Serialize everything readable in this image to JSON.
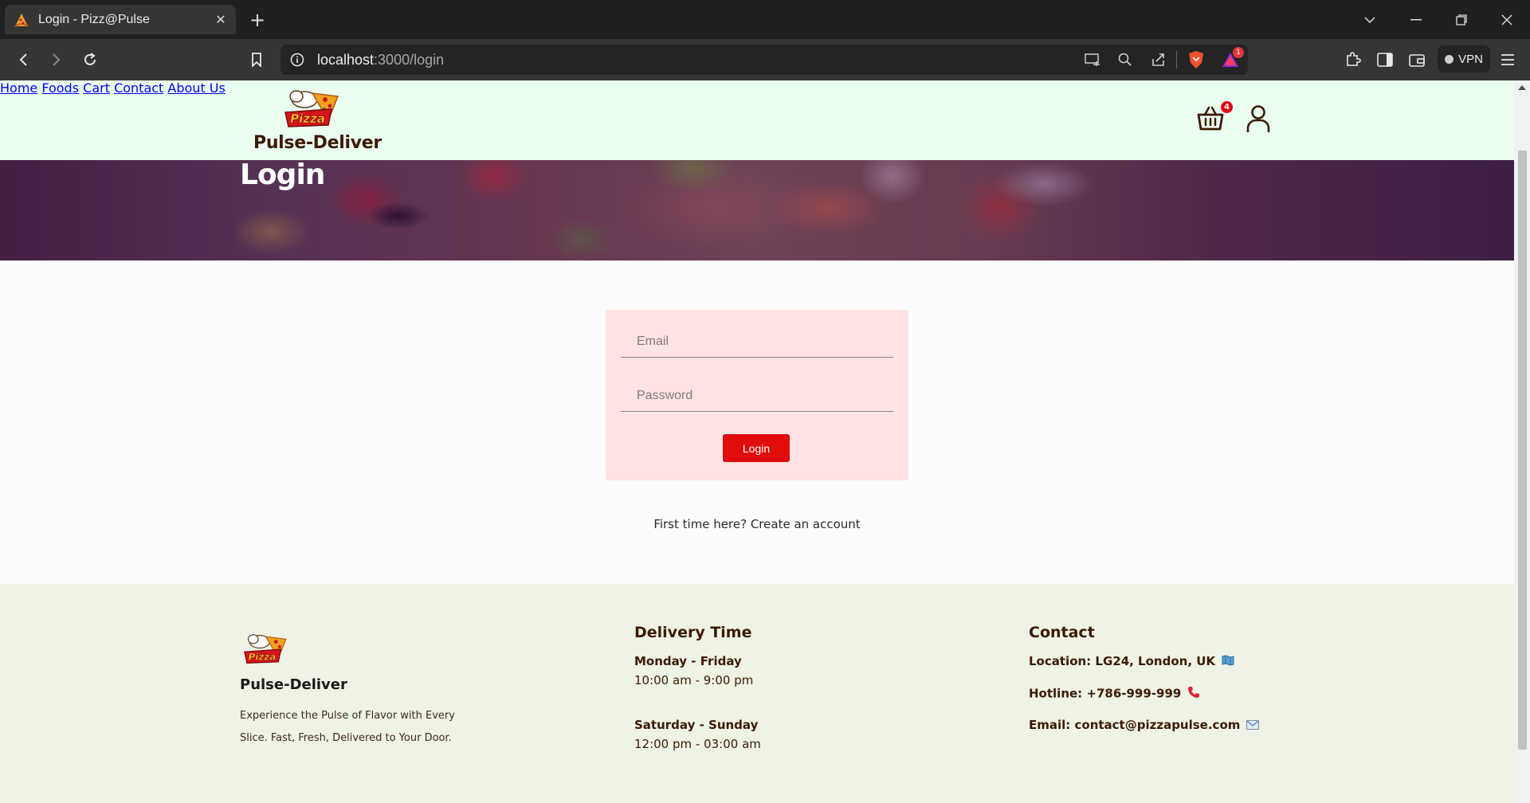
{
  "browser": {
    "tab_title": "Login - Pizz@Pulse",
    "url_host": "localhost",
    "url_path": ":3000/login",
    "vpn_label": "VPN"
  },
  "header": {
    "brand": "Pulse-Deliver",
    "nav": [
      "Home",
      "Foods",
      "Cart",
      "Contact",
      "About Us"
    ],
    "cart_count": "4"
  },
  "hero": {
    "title": "Login"
  },
  "login": {
    "email_placeholder": "Email",
    "password_placeholder": "Password",
    "button_label": "Login",
    "create_account_text": "First time here? Create an account"
  },
  "footer": {
    "brand": "Pulse-Deliver",
    "description": "Experience the Pulse of Flavor with Every Slice. Fast, Fresh, Delivered to Your Door.",
    "delivery": {
      "title": "Delivery Time",
      "weekday_label": "Monday - Friday",
      "weekday_hours": "10:00 am - 9:00 pm",
      "weekend_label": "Saturday - Sunday",
      "weekend_hours": "12:00 pm - 03:00 am"
    },
    "contact": {
      "title": "Contact",
      "location": "Location: LG24, London, UK",
      "hotline": "Hotline: +786-999-999",
      "email": "Email: contact@pizzapulse.com"
    }
  },
  "colors": {
    "brand_brown": "#3b1a06",
    "header_bg": "#eaffef",
    "card_bg": "#ffe2e2",
    "button_red": "#e10c0c",
    "footer_bg": "#eff3e5"
  }
}
